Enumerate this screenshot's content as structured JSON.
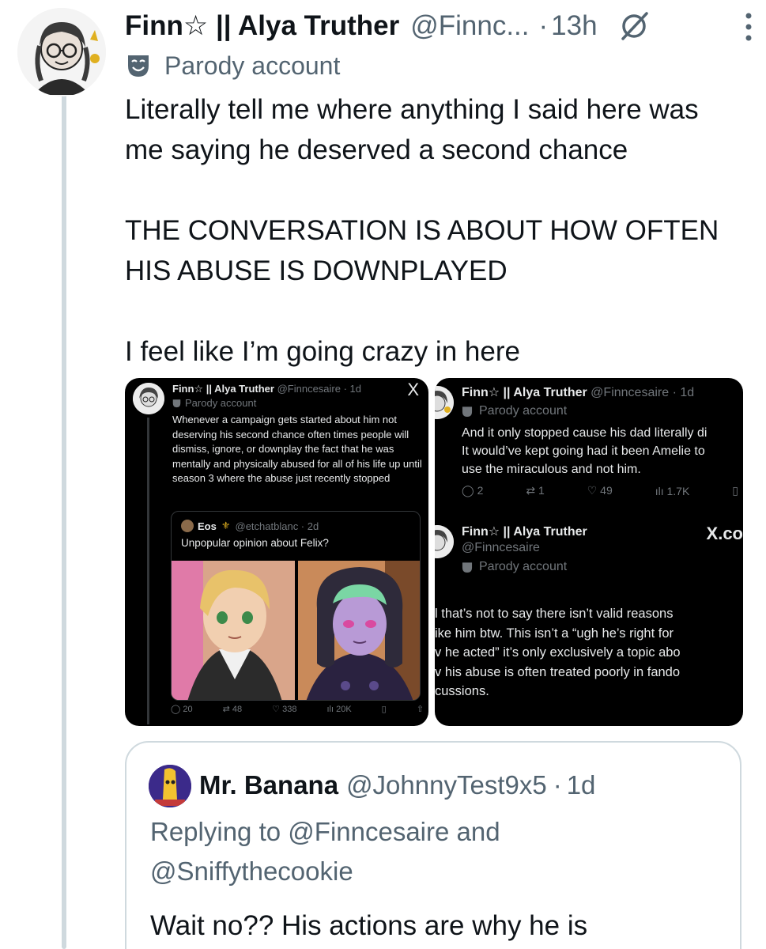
{
  "tweet": {
    "display_name": "Finn☆ || Alya Truther",
    "handle": "@Finnc...",
    "separator": "·",
    "time": "13h",
    "parody_label": "Parody account",
    "text_lines": [
      "Literally tell me where anything I said here was me saying he deserved a second chance",
      "THE CONVERSATION IS ABOUT HOW OFTEN HIS ABUSE IS DOWNPLAYED",
      "I feel like I’m going crazy in here"
    ],
    "icons": [
      "grok-icon",
      "more-icon",
      "parody-mask-icon"
    ]
  },
  "media_left": {
    "display_name": "Finn☆ || Alya Truther",
    "handle_time": "@Finncesaire · 1d",
    "parody_label": "Parody account",
    "text": "Whenever a campaign gets started about him not deserving his second chance often times people will dismiss, ignore, or downplay  the fact that he was mentally and physically abused for all of his life up until season 3 where the abuse just recently stopped",
    "quoted_name": "Eos",
    "quoted_handle_time": "@etchatblanc · 2d",
    "quoted_text": "Unpopular opinion about Felix?",
    "stats": {
      "replies": "20",
      "reposts": "48",
      "likes": "338",
      "views": "20K"
    },
    "x_logo": "X"
  },
  "media_right": {
    "display_name": "Finn☆ || Alya Truther",
    "handle_time": "@Finncesaire · 1d",
    "parody_label": "Parody account",
    "text_lines": [
      "And it only stopped cause his dad literally di",
      "It would’ve kept going had it been Amelie to",
      "use the miraculous and not him."
    ],
    "stats": {
      "replies": "2",
      "reposts": "1",
      "likes": "49",
      "views": "1.7K"
    },
    "second_name": "Finn☆ || Alya Truther",
    "second_handle": "@Finncesaire",
    "second_parody": "Parody account",
    "watermark": "X.co",
    "second_text_lines": [
      "l that’s not to say there isn’t valid reasons",
      "ike him btw. This isn’t a “ugh he’s right for",
      "v he acted” it’s only exclusively a topic abo",
      "v his abuse is often treated poorly in fando",
      "cussions."
    ]
  },
  "quote": {
    "display_name": "Mr. Banana",
    "handle": "@JohnnyTest9x5",
    "separator": "·",
    "time": "1d",
    "replying_prefix": "Replying to",
    "mention_1": "@Finncesaire",
    "and_word": "and",
    "mention_2": "@Sniffythecookie",
    "text": "Wait no?? His actions are why he is"
  }
}
